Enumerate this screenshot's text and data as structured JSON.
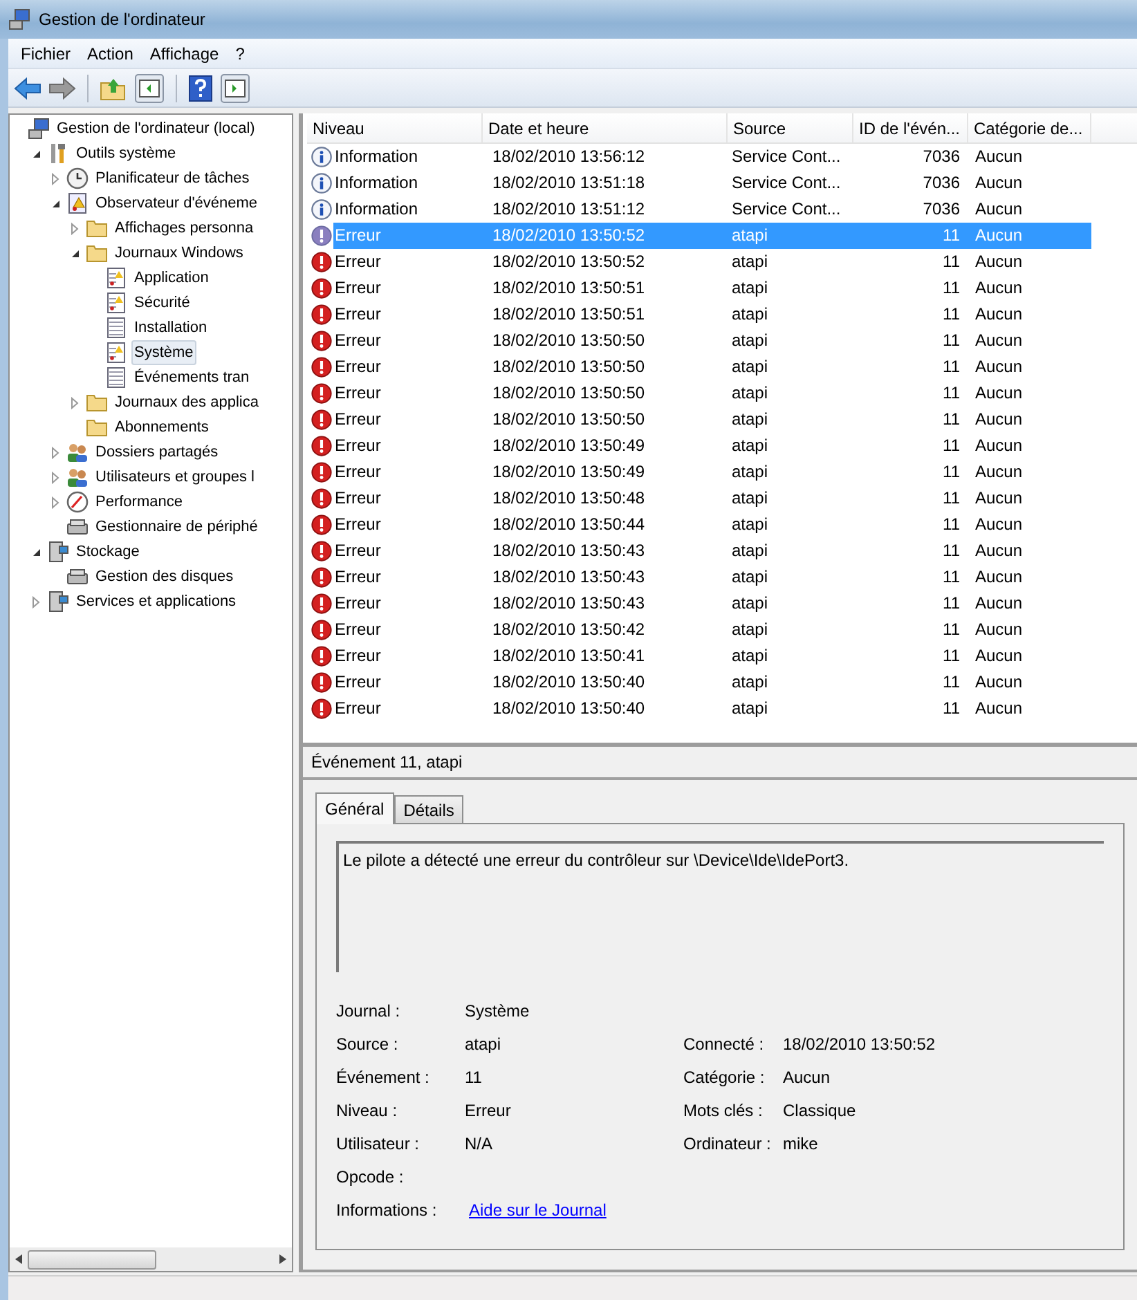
{
  "window": {
    "title": "Gestion de l'ordinateur"
  },
  "menu": [
    "Fichier",
    "Action",
    "Affichage",
    "?"
  ],
  "toolbar": [
    {
      "kind": "back"
    },
    {
      "kind": "forward"
    },
    {
      "kind": "sep"
    },
    {
      "kind": "up"
    },
    {
      "kind": "panel-left"
    },
    {
      "kind": "sep"
    },
    {
      "kind": "help"
    },
    {
      "kind": "panel-right"
    }
  ],
  "tree": [
    {
      "label": "Gestion de l'ordinateur (local)",
      "kind": "computer",
      "selected": false,
      "children": [
        {
          "label": "Outils système",
          "kind": "tools",
          "expanded": true,
          "selected": false,
          "children": [
            {
              "label": "Planificateur de tâches",
              "kind": "clock",
              "expanded": false,
              "selected": false
            },
            {
              "label": "Observateur d'événeme",
              "kind": "viewer",
              "expanded": true,
              "selected": false,
              "children": [
                {
                  "label": "Affichages personna",
                  "kind": "folder",
                  "expanded": false,
                  "selected": false
                },
                {
                  "label": "Journaux Windows",
                  "kind": "folder",
                  "expanded": true,
                  "selected": false,
                  "children": [
                    {
                      "label": "Application",
                      "kind": "log-warn",
                      "selected": false
                    },
                    {
                      "label": "Sécurité",
                      "kind": "log-warn",
                      "selected": false
                    },
                    {
                      "label": "Installation",
                      "kind": "log",
                      "selected": false
                    },
                    {
                      "label": "Système",
                      "kind": "log-warn",
                      "selected": true
                    },
                    {
                      "label": "Événements tran",
                      "kind": "log",
                      "selected": false
                    }
                  ]
                },
                {
                  "label": "Journaux des applica",
                  "kind": "folder",
                  "expanded": false,
                  "selected": false
                },
                {
                  "label": "Abonnements",
                  "kind": "folder",
                  "selected": false
                }
              ]
            },
            {
              "label": "Dossiers partagés",
              "kind": "group",
              "expanded": false,
              "selected": false
            },
            {
              "label": "Utilisateurs et groupes l",
              "kind": "group",
              "expanded": false,
              "selected": false
            },
            {
              "label": "Performance",
              "kind": "gauge",
              "expanded": false,
              "selected": false
            },
            {
              "label": "Gestionnaire de périphé",
              "kind": "device",
              "selected": false
            }
          ]
        },
        {
          "label": "Stockage",
          "kind": "storage",
          "expanded": true,
          "selected": false,
          "children": [
            {
              "label": "Gestion des disques",
              "kind": "device",
              "selected": false
            }
          ]
        },
        {
          "label": "Services et applications",
          "kind": "storage",
          "expanded": false,
          "selected": false
        }
      ]
    }
  ],
  "table": {
    "columns": [
      "Niveau",
      "Date et heure",
      "Source",
      "ID de l'évén...",
      "Catégorie de..."
    ],
    "rows": [
      {
        "kind": "info",
        "niveau": "Information",
        "date": "18/02/2010 13:56:12",
        "source": "Service Cont...",
        "id": "7036",
        "category": "Aucun",
        "selected": false
      },
      {
        "kind": "info",
        "niveau": "Information",
        "date": "18/02/2010 13:51:18",
        "source": "Service Cont...",
        "id": "7036",
        "category": "Aucun",
        "selected": false
      },
      {
        "kind": "info",
        "niveau": "Information",
        "date": "18/02/2010 13:51:12",
        "source": "Service Cont...",
        "id": "7036",
        "category": "Aucun",
        "selected": false
      },
      {
        "kind": "error",
        "niveau": "Erreur",
        "date": "18/02/2010 13:50:52",
        "source": "atapi",
        "id": "11",
        "category": "Aucun",
        "selected": true
      },
      {
        "kind": "error",
        "niveau": "Erreur",
        "date": "18/02/2010 13:50:52",
        "source": "atapi",
        "id": "11",
        "category": "Aucun",
        "selected": false
      },
      {
        "kind": "error",
        "niveau": "Erreur",
        "date": "18/02/2010 13:50:51",
        "source": "atapi",
        "id": "11",
        "category": "Aucun",
        "selected": false
      },
      {
        "kind": "error",
        "niveau": "Erreur",
        "date": "18/02/2010 13:50:51",
        "source": "atapi",
        "id": "11",
        "category": "Aucun",
        "selected": false
      },
      {
        "kind": "error",
        "niveau": "Erreur",
        "date": "18/02/2010 13:50:50",
        "source": "atapi",
        "id": "11",
        "category": "Aucun",
        "selected": false
      },
      {
        "kind": "error",
        "niveau": "Erreur",
        "date": "18/02/2010 13:50:50",
        "source": "atapi",
        "id": "11",
        "category": "Aucun",
        "selected": false
      },
      {
        "kind": "error",
        "niveau": "Erreur",
        "date": "18/02/2010 13:50:50",
        "source": "atapi",
        "id": "11",
        "category": "Aucun",
        "selected": false
      },
      {
        "kind": "error",
        "niveau": "Erreur",
        "date": "18/02/2010 13:50:50",
        "source": "atapi",
        "id": "11",
        "category": "Aucun",
        "selected": false
      },
      {
        "kind": "error",
        "niveau": "Erreur",
        "date": "18/02/2010 13:50:49",
        "source": "atapi",
        "id": "11",
        "category": "Aucun",
        "selected": false
      },
      {
        "kind": "error",
        "niveau": "Erreur",
        "date": "18/02/2010 13:50:49",
        "source": "atapi",
        "id": "11",
        "category": "Aucun",
        "selected": false
      },
      {
        "kind": "error",
        "niveau": "Erreur",
        "date": "18/02/2010 13:50:48",
        "source": "atapi",
        "id": "11",
        "category": "Aucun",
        "selected": false
      },
      {
        "kind": "error",
        "niveau": "Erreur",
        "date": "18/02/2010 13:50:44",
        "source": "atapi",
        "id": "11",
        "category": "Aucun",
        "selected": false
      },
      {
        "kind": "error",
        "niveau": "Erreur",
        "date": "18/02/2010 13:50:43",
        "source": "atapi",
        "id": "11",
        "category": "Aucun",
        "selected": false
      },
      {
        "kind": "error",
        "niveau": "Erreur",
        "date": "18/02/2010 13:50:43",
        "source": "atapi",
        "id": "11",
        "category": "Aucun",
        "selected": false
      },
      {
        "kind": "error",
        "niveau": "Erreur",
        "date": "18/02/2010 13:50:43",
        "source": "atapi",
        "id": "11",
        "category": "Aucun",
        "selected": false
      },
      {
        "kind": "error",
        "niveau": "Erreur",
        "date": "18/02/2010 13:50:42",
        "source": "atapi",
        "id": "11",
        "category": "Aucun",
        "selected": false
      },
      {
        "kind": "error",
        "niveau": "Erreur",
        "date": "18/02/2010 13:50:41",
        "source": "atapi",
        "id": "11",
        "category": "Aucun",
        "selected": false
      },
      {
        "kind": "error",
        "niveau": "Erreur",
        "date": "18/02/2010 13:50:40",
        "source": "atapi",
        "id": "11",
        "category": "Aucun",
        "selected": false
      },
      {
        "kind": "error",
        "niveau": "Erreur",
        "date": "18/02/2010 13:50:40",
        "source": "atapi",
        "id": "11",
        "category": "Aucun",
        "selected": false
      }
    ]
  },
  "event": {
    "title": "Événement 11, atapi",
    "tabs": [
      {
        "label": "Général",
        "selected": true
      },
      {
        "label": "Détails",
        "selected": false
      }
    ],
    "message": "Le pilote a détecté une erreur du contrôleur sur \\Device\\Ide\\IdePort3.",
    "fields": [
      {
        "label": "Journal :",
        "value": "Système"
      },
      {
        "label": "Source :",
        "value": "atapi",
        "label_2": "Connecté :",
        "value_2": "18/02/2010 13:50:52"
      },
      {
        "label": "Événement :",
        "value": "11",
        "label_2": "Catégorie :",
        "value_2": "Aucun"
      },
      {
        "label": "Niveau :",
        "value": "Erreur",
        "label_2": "Mots clés :",
        "value_2": "Classique"
      },
      {
        "label": "Utilisateur :",
        "value": "N/A",
        "label_2": "Ordinateur :",
        "value_2": "mike"
      },
      {
        "label": "Opcode :"
      },
      {
        "label": "Informations :",
        "link": "Aide sur le Journal"
      }
    ]
  }
}
